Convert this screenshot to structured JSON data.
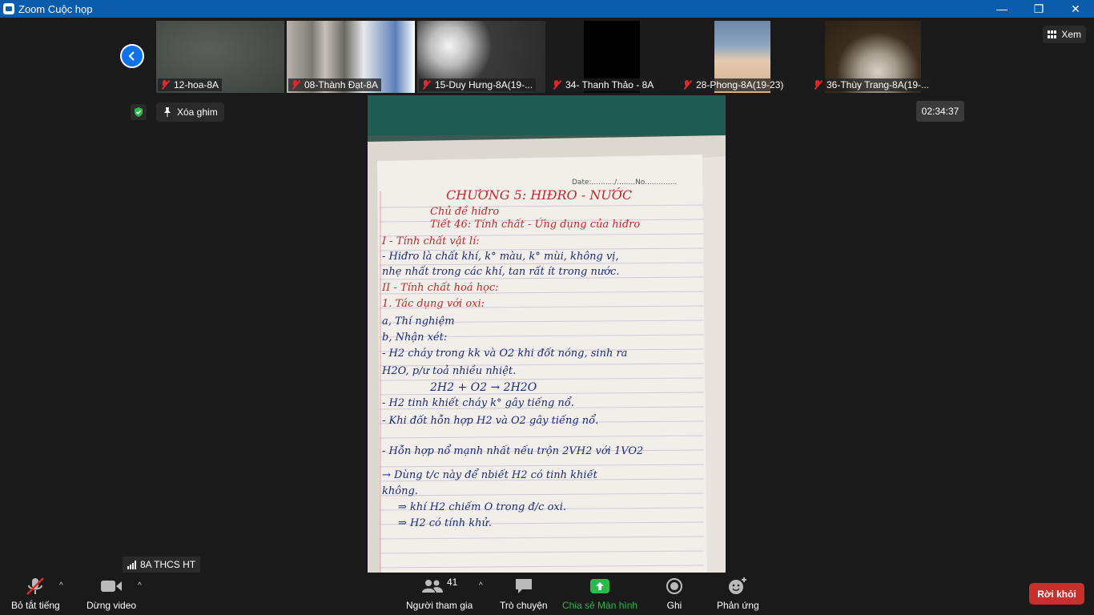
{
  "window": {
    "title": "Zoom Cuộc họp",
    "minimize": "—",
    "maximize": "❐",
    "close": "✕"
  },
  "participants": [
    {
      "name": "12-hoa-8A",
      "tone": "#4a4f4c"
    },
    {
      "name": "08-Thành Đạt-8A",
      "tone": "#8e8b86"
    },
    {
      "name": "15-Duy Hưng-8A(19-...",
      "tone": "#3b3b3b"
    },
    {
      "name": "34- Thanh Thảo - 8A",
      "tone": "#000000"
    },
    {
      "name": "28-Phong-8A(19-23)",
      "tone": "#c8a98a"
    },
    {
      "name": "36-Thùy Trang-8A(19-...",
      "tone": "#4a3a28"
    }
  ],
  "view_button": "Xem",
  "unpin_button": "Xóa ghim",
  "timer": "02:34:37",
  "connection_label": "8A THCS HT",
  "notebook": {
    "date_line": "Date:........../........No..............",
    "lines": [
      "CHƯƠNG 5: HIĐRO - NƯỚC",
      "Chủ đề hiđro",
      "Tiết 46: Tính chất - Ứng dụng của hiđro",
      "I - Tính chất vật lí:",
      "- Hiđro là chất khí, k° màu, k° mùi, không vị,",
      "nhẹ nhất trong các khí, tan rất ít trong nước.",
      "II - Tính chất hoá học:",
      "1. Tác dụng với oxi:",
      "a, Thí nghiệm",
      "b, Nhận xét:",
      "- H2 cháy trong kk và O2 khi đốt nóng, sinh ra",
      "H2O, p/ư toả nhiều nhiệt.",
      "2H2 + O2 → 2H2O",
      "- H2 tinh khiết cháy k° gây tiếng nổ.",
      "- Khi đốt hỗn hợp H2 và O2 gây tiếng nổ.",
      "- Hỗn hợp nổ mạnh nhất nếu trộn 2VH2 với 1VO2",
      "→ Dùng t/c này để nbiết H2 có tinh khiết",
      "không.",
      "⇒ khí H2 chiếm O trong đ/c oxi.",
      "⇒ H2 có tính khử."
    ]
  },
  "toolbar": {
    "mute": "Bỏ tắt tiếng",
    "video": "Dừng video",
    "participants": "Người tham gia",
    "participants_count": "41",
    "chat": "Trò chuyện",
    "share": "Chia sẻ Màn hình",
    "record": "Ghi",
    "reactions": "Phản ứng",
    "leave": "Rời khỏi",
    "caret": "^"
  },
  "colors": {
    "titlebar": "#0b5cab",
    "accent": "#0e72ed",
    "leave": "#c9302c",
    "share": "#2db84b",
    "ink_red": "#c0282d",
    "ink_blue": "#1c2a78"
  }
}
